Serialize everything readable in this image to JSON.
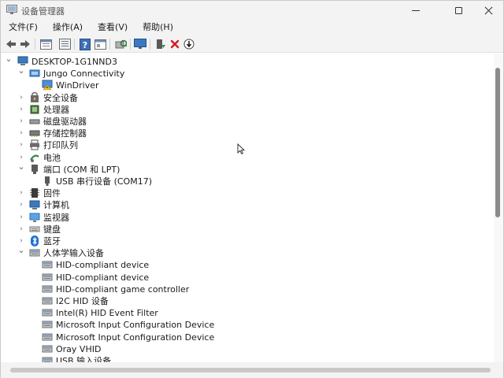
{
  "window": {
    "title": "设备管理器"
  },
  "menu": [
    "文件(F)",
    "操作(A)",
    "查看(V)",
    "帮助(H)"
  ],
  "colors": {
    "accent": "#0067c0",
    "delete_red": "#d21f1f",
    "folder_yellow": "#e7b73c"
  },
  "toolbar_icons": [
    "back-arrow-icon",
    "forward-arrow-icon",
    "properties-icon",
    "device-list-icon",
    "help-icon",
    "view-icon",
    "scan-hardware-icon",
    "monitor-icon",
    "update-driver-icon",
    "uninstall-icon",
    "download-icon"
  ],
  "tree": [
    {
      "label": "DESKTOP-1G1NND3",
      "level": 0,
      "expanded": true,
      "icon": "computer-root-icon"
    },
    {
      "label": "Jungo Connectivity",
      "level": 1,
      "expanded": true,
      "icon": "jungo-icon"
    },
    {
      "label": "WinDriver",
      "level": 2,
      "icon": "windriver-icon"
    },
    {
      "label": "安全设备",
      "level": 1,
      "expanded": false,
      "icon": "security-device-icon"
    },
    {
      "label": "处理器",
      "level": 1,
      "expanded": false,
      "icon": "processor-icon"
    },
    {
      "label": "磁盘驱动器",
      "level": 1,
      "expanded": false,
      "icon": "disk-drive-icon"
    },
    {
      "label": "存储控制器",
      "level": 1,
      "expanded": false,
      "icon": "storage-controller-icon"
    },
    {
      "label": "打印队列",
      "level": 1,
      "expanded": false,
      "icon": "printer-icon"
    },
    {
      "label": "电池",
      "level": 1,
      "expanded": false,
      "icon": "battery-icon"
    },
    {
      "label": "端口 (COM 和 LPT)",
      "level": 1,
      "expanded": true,
      "icon": "port-icon"
    },
    {
      "label": "USB 串行设备 (COM17)",
      "level": 2,
      "icon": "serial-port-icon"
    },
    {
      "label": "固件",
      "level": 1,
      "expanded": false,
      "icon": "firmware-icon"
    },
    {
      "label": "计算机",
      "level": 1,
      "expanded": false,
      "icon": "computer-icon"
    },
    {
      "label": "监视器",
      "level": 1,
      "expanded": false,
      "icon": "monitor-icon"
    },
    {
      "label": "键盘",
      "level": 1,
      "expanded": false,
      "icon": "keyboard-icon"
    },
    {
      "label": "蓝牙",
      "level": 1,
      "expanded": false,
      "icon": "bluetooth-icon"
    },
    {
      "label": "人体学输入设备",
      "level": 1,
      "expanded": true,
      "icon": "hid-icon"
    },
    {
      "label": "HID-compliant device",
      "level": 2,
      "icon": "hid-icon"
    },
    {
      "label": "HID-compliant device",
      "level": 2,
      "icon": "hid-icon"
    },
    {
      "label": "HID-compliant game controller",
      "level": 2,
      "icon": "hid-icon"
    },
    {
      "label": "I2C HID 设备",
      "level": 2,
      "icon": "hid-icon"
    },
    {
      "label": "Intel(R) HID Event Filter",
      "level": 2,
      "icon": "hid-icon"
    },
    {
      "label": "Microsoft Input Configuration Device",
      "level": 2,
      "icon": "hid-icon"
    },
    {
      "label": "Microsoft Input Configuration Device",
      "level": 2,
      "icon": "hid-icon"
    },
    {
      "label": "Oray VHID",
      "level": 2,
      "icon": "hid-icon"
    },
    {
      "label": "USB 输入设备",
      "level": 2,
      "icon": "hid-icon"
    }
  ]
}
